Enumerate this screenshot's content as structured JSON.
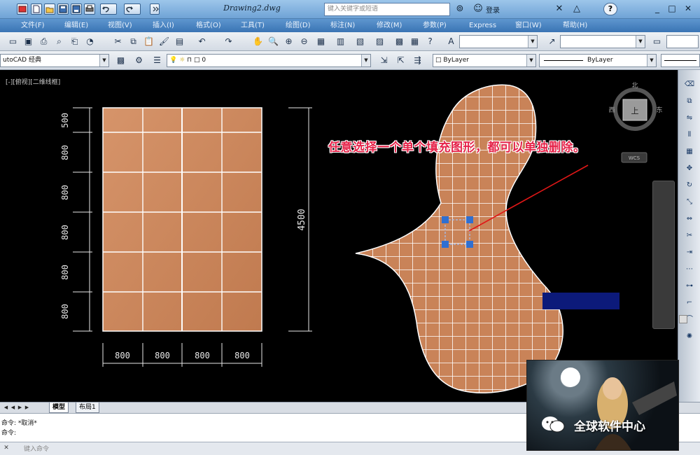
{
  "window": {
    "title": "Drawing2.dwg",
    "search_placeholder": "键入关键字或短语",
    "login_label": "登录"
  },
  "menu": {
    "items": [
      "文件(F)",
      "编辑(E)",
      "视图(V)",
      "插入(I)",
      "格式(O)",
      "工具(T)",
      "绘图(D)",
      "标注(N)",
      "修改(M)",
      "参数(P)",
      "Express",
      "窗口(W)",
      "帮助(H)"
    ]
  },
  "toolbar": {
    "workspace": "utoCAD 经典",
    "layer": "0",
    "color": "ByLayer",
    "linetype": "ByLayer",
    "lineweight": "ByLayer"
  },
  "viewport": {
    "label": "[-][俯视][二维线框]"
  },
  "drawing": {
    "row_dims": [
      "500",
      "800",
      "800",
      "800",
      "800",
      "800"
    ],
    "col_dims": [
      "800",
      "800",
      "800",
      "800"
    ],
    "total_height": "4500",
    "tile_color": "#c98358",
    "grip_color": "#2f6fd1"
  },
  "viewcube": {
    "top": "北",
    "left": "西",
    "right": "东",
    "center": "上",
    "wcs": "WCS"
  },
  "annotation": {
    "text": "任意选择一个单个填充图形，都可以单独删除。",
    "color": "#e5244a"
  },
  "tabs": {
    "model": "模型",
    "layout1": "布局1"
  },
  "command": {
    "line1": "命令: *取消*",
    "line2": "命令:",
    "input_placeholder": "键入命令"
  },
  "watermark": {
    "caption": "全球软件中心"
  }
}
